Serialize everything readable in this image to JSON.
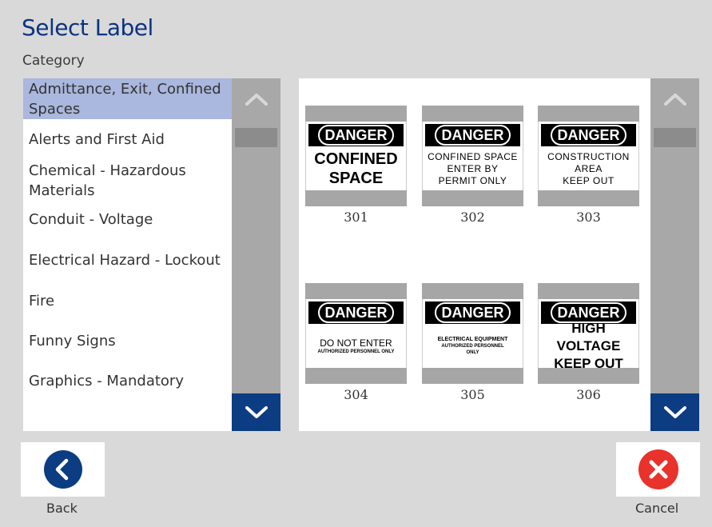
{
  "header": {
    "title": "Select Label",
    "subtitle": "Category"
  },
  "categories": [
    {
      "label": "Admittance, Exit, Confined Spaces",
      "selected": true
    },
    {
      "label": "Alerts and First Aid"
    },
    {
      "label": "Chemical - Hazardous Materials"
    },
    {
      "label": "Conduit - Voltage"
    },
    {
      "label": "Electrical Hazard - Lockout"
    },
    {
      "label": "Fire"
    },
    {
      "label": "Funny Signs"
    },
    {
      "label": "Graphics - Mandatory"
    }
  ],
  "labels": [
    {
      "number": "301",
      "header": "DANGER",
      "lines": [
        "CONFINED",
        "SPACE"
      ]
    },
    {
      "number": "302",
      "header": "DANGER",
      "lines": [
        "CONFINED SPACE",
        "ENTER BY",
        "PERMIT ONLY"
      ]
    },
    {
      "number": "303",
      "header": "DANGER",
      "lines": [
        "CONSTRUCTION",
        "AREA",
        "KEEP OUT"
      ]
    },
    {
      "number": "304",
      "header": "DANGER",
      "lines": [
        "DO NOT ENTER",
        "AUTHORIZED PERSONNEL ONLY"
      ]
    },
    {
      "number": "305",
      "header": "DANGER",
      "lines": [
        "ELECTRICAL EQUIPMENT",
        "AUTHORIZED PERSONNEL",
        "ONLY"
      ]
    },
    {
      "number": "306",
      "header": "DANGER",
      "lines": [
        "HIGH VOLTAGE",
        "KEEP OUT"
      ]
    }
  ],
  "footer": {
    "back_label": "Back",
    "cancel_label": "Cancel"
  },
  "icons": {
    "up": "chevron-up-icon",
    "down": "chevron-down-icon",
    "back": "chevron-left-circle-icon",
    "cancel": "close-circle-icon"
  },
  "colors": {
    "accent": "#0c3c82",
    "title": "#0b3380",
    "selection": "#aab7de",
    "cancel": "#e8322b",
    "background": "#d9d9d9"
  }
}
